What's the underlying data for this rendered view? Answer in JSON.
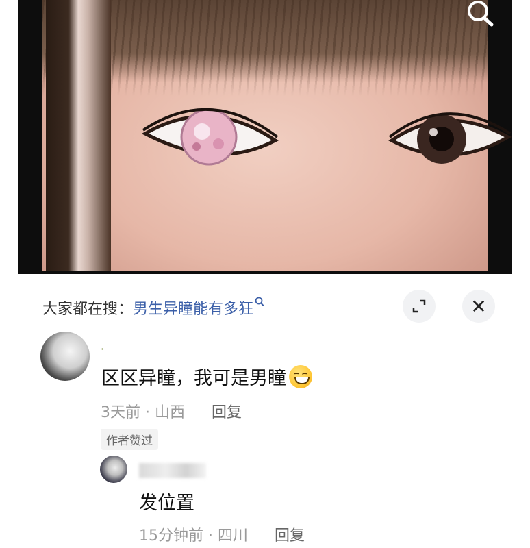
{
  "sheet": {
    "search_prefix": "大家都在搜：",
    "search_keyword": "男生异瞳能有多狂",
    "close_glyph": "✕"
  },
  "comments": [
    {
      "author_name": "·",
      "text": "区区异瞳，我可是男瞳",
      "emoji": "grinning-face-icon",
      "time": "3天前",
      "location": "山西",
      "reply_label": "回复",
      "badge": "作者赞过"
    },
    {
      "text": "发位置",
      "time": "15分钟前",
      "location": "四川",
      "reply_label": "回复"
    }
  ],
  "colors": {
    "keyword": "#3b5fa8",
    "meta_text": "#9a9a9a",
    "button_bg": "#f1f2f4"
  }
}
